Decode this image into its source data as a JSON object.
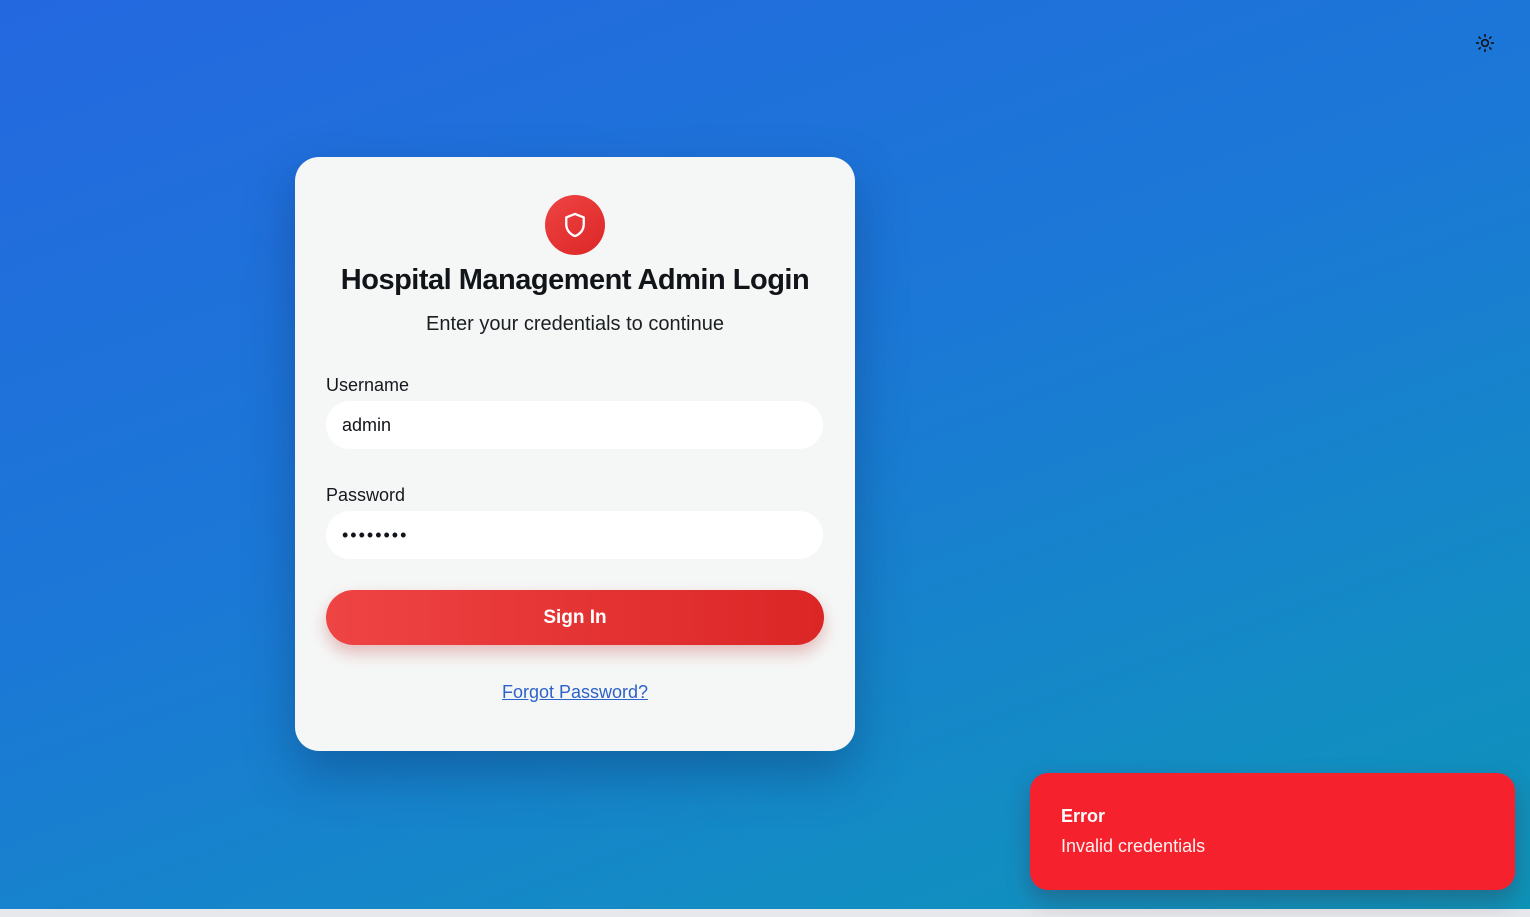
{
  "login": {
    "title": "Hospital Management Admin Login",
    "subtitle": "Enter your credentials to continue",
    "username_label": "Username",
    "username_value": "admin",
    "password_label": "Password",
    "password_value": "••••••••",
    "signin_label": "Sign In",
    "forgot_label": "Forgot Password?",
    "logo_icon": "shield-icon"
  },
  "theme_toggle": {
    "icon": "sun-icon"
  },
  "toast": {
    "title": "Error",
    "message": "Invalid credentials",
    "color": "#f5222d"
  },
  "colors": {
    "accent": "#ef4444",
    "link": "#2d62c9",
    "background_start": "#2468e0",
    "background_end": "#0d93b8"
  }
}
